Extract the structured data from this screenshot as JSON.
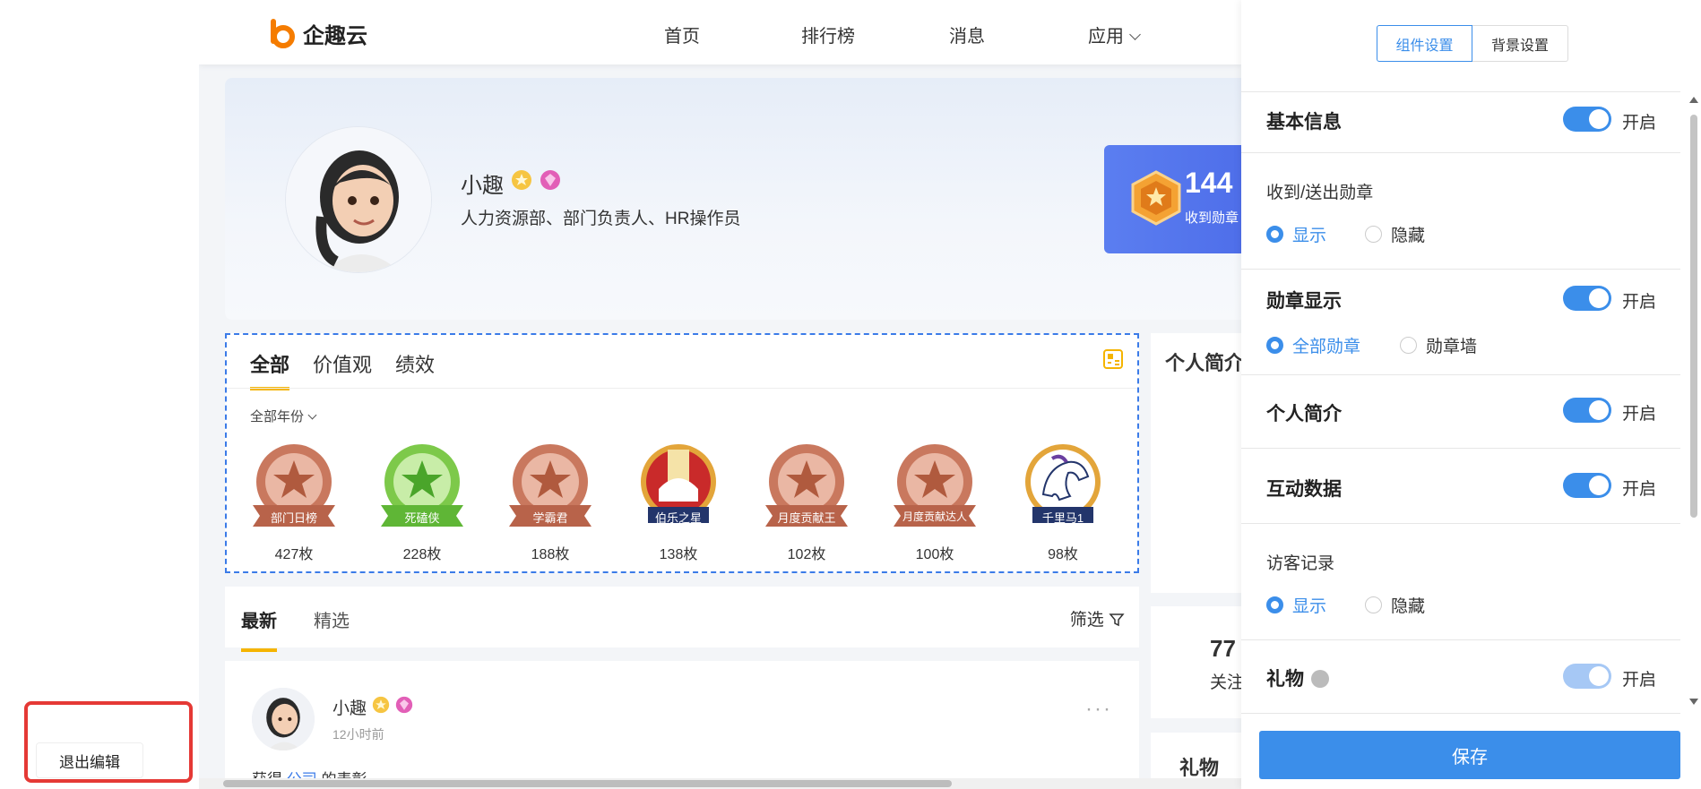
{
  "nav": {
    "logo_text": "企趣云",
    "items": [
      "首页",
      "排行榜",
      "消息",
      "应用"
    ]
  },
  "profile": {
    "name": "小趣",
    "roles": "人力资源部、部门负责人、HR操作员",
    "stat_value": "144",
    "stat_label": "收到勋章"
  },
  "badges": {
    "tabs": [
      "全部",
      "价值观",
      "绩效"
    ],
    "year_filter": "全部年份",
    "medals": [
      {
        "label": "部门日榜",
        "count": "427枚"
      },
      {
        "label": "死磕侠",
        "count": "228枚"
      },
      {
        "label": "学霸君",
        "count": "188枚"
      },
      {
        "label": "伯乐之星",
        "count": "138枚"
      },
      {
        "label": "月度贡献王",
        "count": "102枚"
      },
      {
        "label": "月度贡献达人",
        "count": "100枚"
      },
      {
        "label": "千里马1",
        "count": "98枚"
      }
    ]
  },
  "side_cards": {
    "intro_title": "个人简介",
    "follow_count": "77",
    "follow_label": "关注",
    "gift_title": "礼物"
  },
  "feed": {
    "tabs": [
      "最新",
      "精选"
    ],
    "filter_label": "筛选",
    "post": {
      "name": "小趣",
      "time": "12小时前",
      "more": "···",
      "text_prefix": "获得",
      "text_link": "公司",
      "text_suffix": "的表彰"
    }
  },
  "left": {
    "exit_label": "退出编辑"
  },
  "panel": {
    "seg_tabs": [
      "组件设置",
      "背景设置"
    ],
    "on_label": "开启",
    "sections": {
      "basic": "基本信息",
      "received_sent": "收到/送出勋章",
      "medal_display": "勋章显示",
      "intro": "个人简介",
      "interaction": "互动数据",
      "visitor": "访客记录",
      "gift": "礼物"
    },
    "radio": {
      "show": "显示",
      "hide": "隐藏",
      "all_medals": "全部勋章",
      "medal_wall": "勋章墙"
    },
    "save_label": "保存"
  }
}
